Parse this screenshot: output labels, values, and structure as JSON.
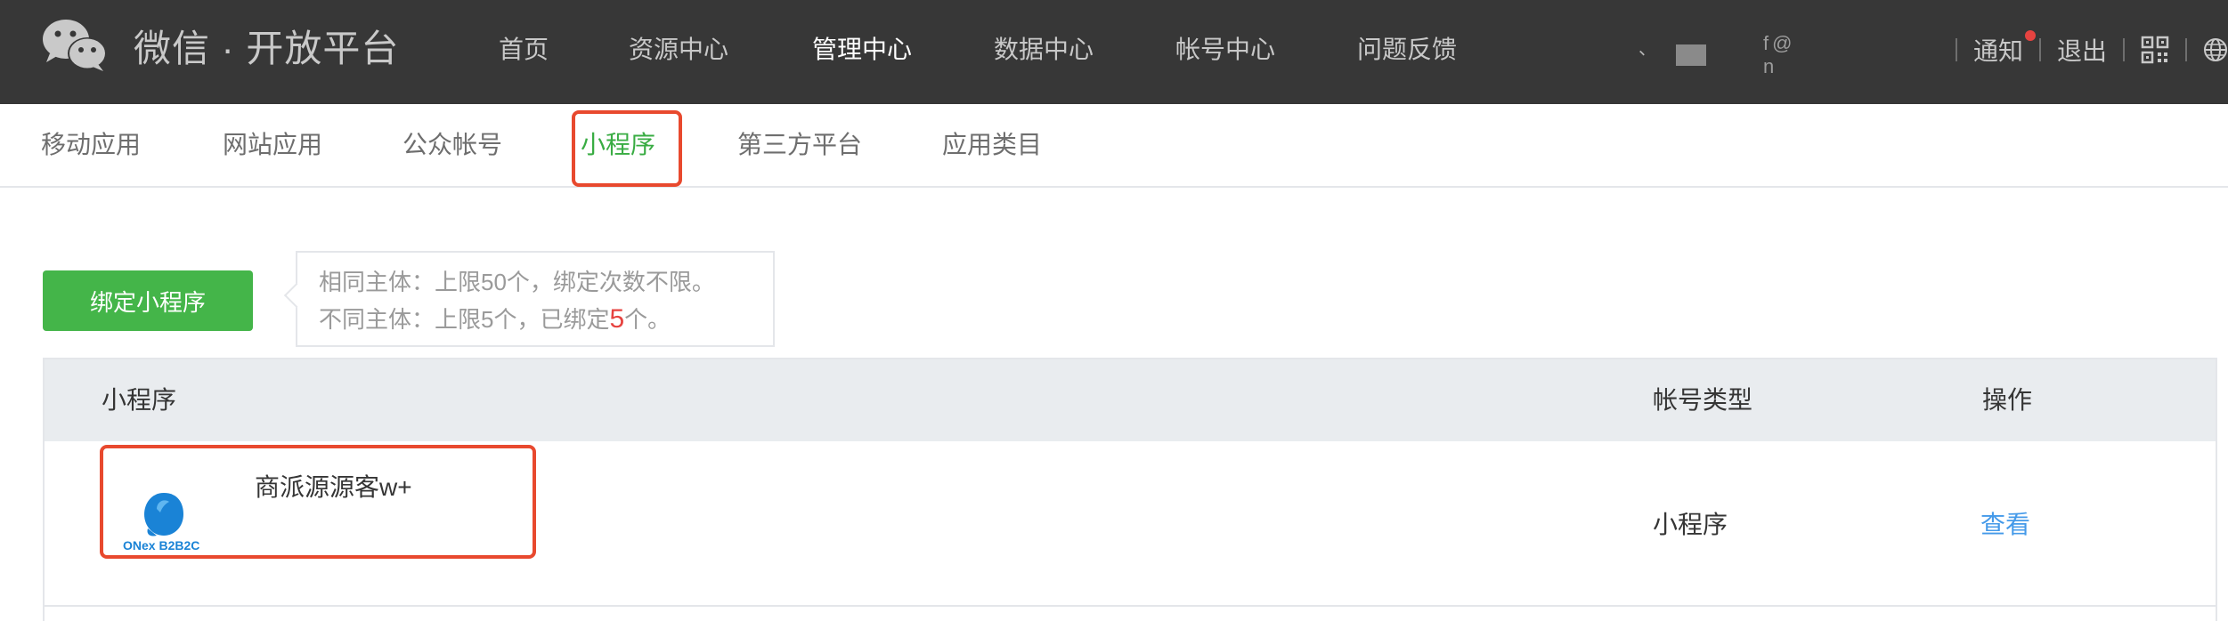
{
  "header": {
    "logo_text": "微信 · 开放平台",
    "nav": [
      {
        "label": "首页",
        "active": false
      },
      {
        "label": "资源中心",
        "active": false
      },
      {
        "label": "管理中心",
        "active": true
      },
      {
        "label": "数据中心",
        "active": false
      },
      {
        "label": "帐号中心",
        "active": false
      },
      {
        "label": "问题反馈",
        "active": false
      }
    ],
    "account_masked_a": "、",
    "account_masked_b": "f@  n",
    "notify_label": "通知",
    "logout_label": "退出",
    "icons": [
      "wechat-logo-icon",
      "qrcode-icon",
      "globe-icon"
    ],
    "colors": {
      "bar": "#373737",
      "notify_dot": "#e64340"
    }
  },
  "subnav": {
    "tabs": [
      {
        "label": "移动应用",
        "active": false
      },
      {
        "label": "网站应用",
        "active": false
      },
      {
        "label": "公众帐号",
        "active": false
      },
      {
        "label": "小程序",
        "active": true
      },
      {
        "label": "第三方平台",
        "active": false
      },
      {
        "label": "应用类目",
        "active": false
      }
    ],
    "active_color": "#39ac43"
  },
  "bind": {
    "button_label": "绑定小程序",
    "tip_line1": "相同主体：上限50个，绑定次数不限。",
    "tip_line2_prefix": "不同主体：上限5个，已绑定",
    "tip_line2_count": "5",
    "tip_line2_suffix": "个。"
  },
  "table": {
    "headers": [
      "小程序",
      "帐号类型",
      "操作"
    ],
    "rows": [
      {
        "name": "商派源源客w+",
        "logo_text": "ONex B2B2C",
        "type": "小程序",
        "action": "查看"
      }
    ]
  },
  "highlight_color": "#e8492e"
}
